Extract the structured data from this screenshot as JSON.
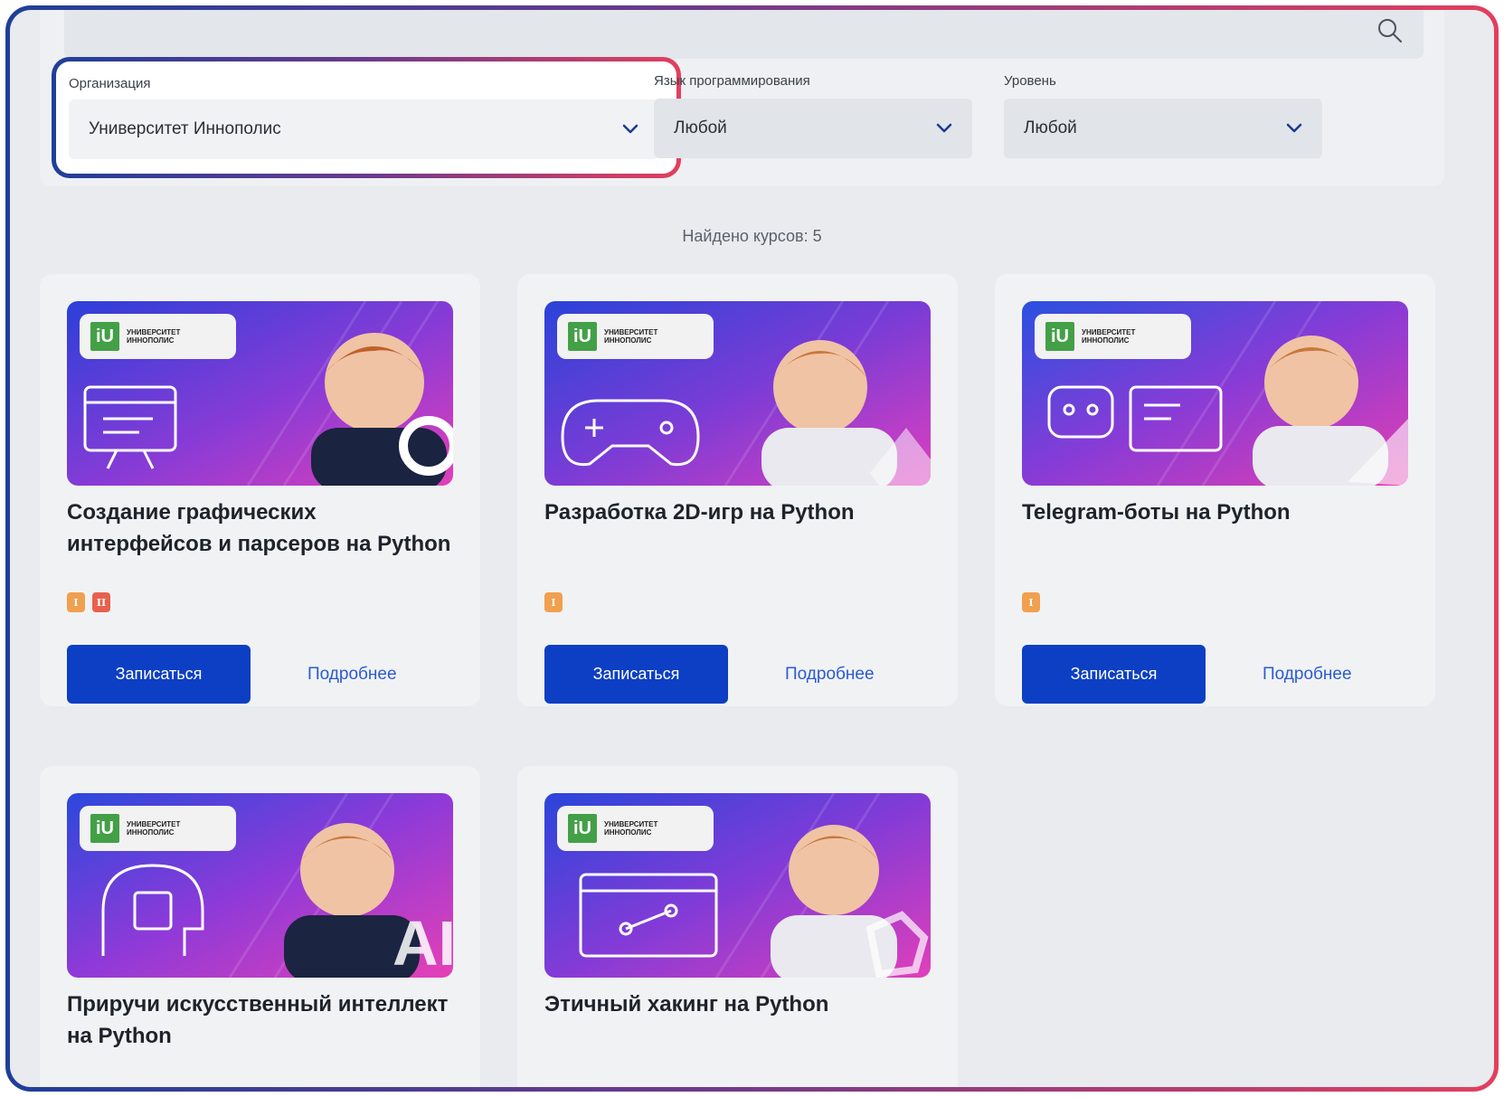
{
  "filters": {
    "organization": {
      "label": "Организация",
      "value": "Университет Иннополис"
    },
    "language": {
      "label": "Язык программирования",
      "value": "Любой"
    },
    "level": {
      "label": "Уровень",
      "value": "Любой"
    }
  },
  "results": {
    "found_text": "Найдено курсов: 5"
  },
  "logo_text": "УНИВЕРСИТЕТ ИННОПОЛИС",
  "courses": [
    {
      "title": "Создание графических интерфейсов и парсеров на Python",
      "badges": [
        "I",
        "II"
      ],
      "enroll": "Записаться",
      "more": "Подробнее",
      "icon": "code-window-icon"
    },
    {
      "title": "Разработка 2D-игр на Python",
      "badges": [
        "I"
      ],
      "enroll": "Записаться",
      "more": "Подробнее",
      "icon": "gamepad-icon"
    },
    {
      "title": "Telegram-боты на Python",
      "badges": [
        "I"
      ],
      "enroll": "Записаться",
      "more": "Подробнее",
      "icon": "robot-icon"
    },
    {
      "title": "Приручи искусственный интеллект на Python",
      "badges": [],
      "enroll": "",
      "more": "",
      "icon": "ai-head-icon"
    },
    {
      "title": "Этичный хакинг на Python",
      "badges": [],
      "enroll": "",
      "more": "",
      "icon": "browser-vector-icon"
    }
  ],
  "colors": {
    "accent_blue": "#0d3fc4",
    "link_blue": "#2a5bd0",
    "badge_level1": "#f0a04e",
    "badge_level2": "#e8614d",
    "gradient_start": "#1f3f9a",
    "gradient_end": "#e23f5e"
  }
}
